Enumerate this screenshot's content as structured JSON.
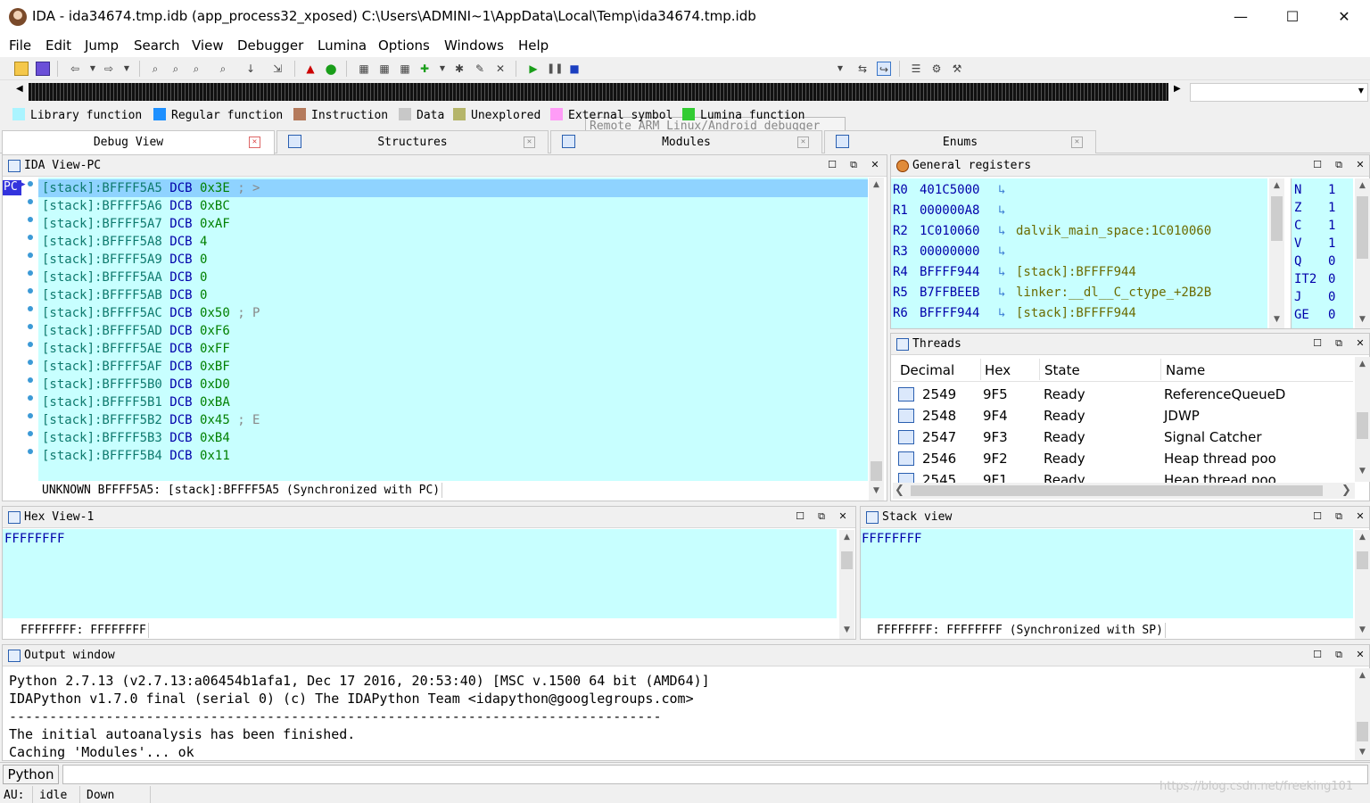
{
  "window": {
    "title": "IDA - ida34674.tmp.idb (app_process32_xposed) C:\\Users\\ADMINI~1\\AppData\\Local\\Temp\\ida34674.tmp.idb",
    "minimize": "—",
    "maximize": "☐",
    "close": "✕"
  },
  "menu": [
    "File",
    "Edit",
    "Jump",
    "Search",
    "View",
    "Debugger",
    "Lumina",
    "Options",
    "Windows",
    "Help"
  ],
  "toolbar": {
    "debugger_select": "Remote ARM Linux/Android debugger"
  },
  "legend": [
    {
      "label": "Library function",
      "color": "#aaf4ff"
    },
    {
      "label": "Regular function",
      "color": "#1e90ff"
    },
    {
      "label": "Instruction",
      "color": "#b47a5c"
    },
    {
      "label": "Data",
      "color": "#c8c8c8"
    },
    {
      "label": "Unexplored",
      "color": "#b5b56a"
    },
    {
      "label": "External symbol",
      "color": "#ff9cf7"
    },
    {
      "label": "Lumina function",
      "color": "#33cc33"
    }
  ],
  "tabs": [
    "Debug View",
    "Structures",
    "Modules",
    "Enums"
  ],
  "ida_view": {
    "title": "IDA View-PC",
    "pc_label": "PC",
    "lines": [
      {
        "addr": "[stack]:BFFFF5A5",
        "op": "DCB",
        "val": "0x3E",
        "cmt": "; >"
      },
      {
        "addr": "[stack]:BFFFF5A6",
        "op": "DCB",
        "val": "0xBC",
        "cmt": ""
      },
      {
        "addr": "[stack]:BFFFF5A7",
        "op": "DCB",
        "val": "0xAF",
        "cmt": ""
      },
      {
        "addr": "[stack]:BFFFF5A8",
        "op": "DCB",
        "val": "   4",
        "cmt": ""
      },
      {
        "addr": "[stack]:BFFFF5A9",
        "op": "DCB",
        "val": "   0",
        "cmt": ""
      },
      {
        "addr": "[stack]:BFFFF5AA",
        "op": "DCB",
        "val": "   0",
        "cmt": ""
      },
      {
        "addr": "[stack]:BFFFF5AB",
        "op": "DCB",
        "val": "   0",
        "cmt": ""
      },
      {
        "addr": "[stack]:BFFFF5AC",
        "op": "DCB",
        "val": "0x50",
        "cmt": "; P"
      },
      {
        "addr": "[stack]:BFFFF5AD",
        "op": "DCB",
        "val": "0xF6",
        "cmt": ""
      },
      {
        "addr": "[stack]:BFFFF5AE",
        "op": "DCB",
        "val": "0xFF",
        "cmt": ""
      },
      {
        "addr": "[stack]:BFFFF5AF",
        "op": "DCB",
        "val": "0xBF",
        "cmt": ""
      },
      {
        "addr": "[stack]:BFFFF5B0",
        "op": "DCB",
        "val": "0xD0",
        "cmt": ""
      },
      {
        "addr": "[stack]:BFFFF5B1",
        "op": "DCB",
        "val": "0xBA",
        "cmt": ""
      },
      {
        "addr": "[stack]:BFFFF5B2",
        "op": "DCB",
        "val": "0x45",
        "cmt": "; E"
      },
      {
        "addr": "[stack]:BFFFF5B3",
        "op": "DCB",
        "val": "0xB4",
        "cmt": ""
      },
      {
        "addr": "[stack]:BFFFF5B4",
        "op": "DCB",
        "val": "0x11",
        "cmt": ""
      }
    ],
    "status": "UNKNOWN BFFFF5A5: [stack]:BFFFF5A5 (Synchronized with PC)"
  },
  "registers": {
    "title": "General registers",
    "rows": [
      {
        "name": "R0",
        "value": "401C5000",
        "comment": ""
      },
      {
        "name": "R1",
        "value": "000000A8",
        "comment": ""
      },
      {
        "name": "R2",
        "value": "1C010060",
        "comment": "dalvik_main_space:1C010060"
      },
      {
        "name": "R3",
        "value": "00000000",
        "comment": ""
      },
      {
        "name": "R4",
        "value": "BFFFF944",
        "comment": "[stack]:BFFFF944"
      },
      {
        "name": "R5",
        "value": "B7FFBEEB",
        "comment": "linker:__dl__C_ctype_+2B2B"
      },
      {
        "name": "R6",
        "value": "BFFFF944",
        "comment": "[stack]:BFFFF944"
      }
    ],
    "flags": [
      {
        "name": "N",
        "value": "1"
      },
      {
        "name": "Z",
        "value": "1"
      },
      {
        "name": "C",
        "value": "1"
      },
      {
        "name": "V",
        "value": "1"
      },
      {
        "name": "Q",
        "value": "0"
      },
      {
        "name": "IT2",
        "value": "0"
      },
      {
        "name": "J",
        "value": "0"
      },
      {
        "name": "GE",
        "value": "0"
      }
    ]
  },
  "threads": {
    "title": "Threads",
    "columns": [
      "Decimal",
      "Hex",
      "State",
      "Name"
    ],
    "rows": [
      {
        "dec": "2549",
        "hex": "9F5",
        "state": "Ready",
        "name": "ReferenceQueueD"
      },
      {
        "dec": "2548",
        "hex": "9F4",
        "state": "Ready",
        "name": "JDWP"
      },
      {
        "dec": "2547",
        "hex": "9F3",
        "state": "Ready",
        "name": "Signal Catcher"
      },
      {
        "dec": "2546",
        "hex": "9F2",
        "state": "Ready",
        "name": "Heap thread poo"
      },
      {
        "dec": "2545",
        "hex": "9F1",
        "state": "Ready",
        "name": "Heap thread poo"
      }
    ]
  },
  "hex_view": {
    "title": "Hex View-1",
    "content": "FFFFFFFF",
    "status": "FFFFFFFF: FFFFFFFF"
  },
  "stack_view": {
    "title": "Stack view",
    "content": "FFFFFFFF",
    "status": "FFFFFFFF: FFFFFFFF (Synchronized with SP)"
  },
  "output": {
    "title": "Output window",
    "lines": [
      "Python 2.7.13 (v2.7.13:a06454b1afa1, Dec 17 2016, 20:53:40) [MSC v.1500 64 bit (AMD64)]",
      "IDAPython v1.7.0 final (serial 0) (c) The IDAPython Team <idapython@googlegroups.com>",
      "---------------------------------------------------------------------------------",
      "The initial autoanalysis has been finished.",
      "Caching 'Modules'... ok"
    ]
  },
  "python_button": "Python",
  "statusbar": {
    "au_label": "AU:",
    "au_state": "idle",
    "direction": "Down"
  },
  "watermark": "https://blog.csdn.net/freeking101"
}
